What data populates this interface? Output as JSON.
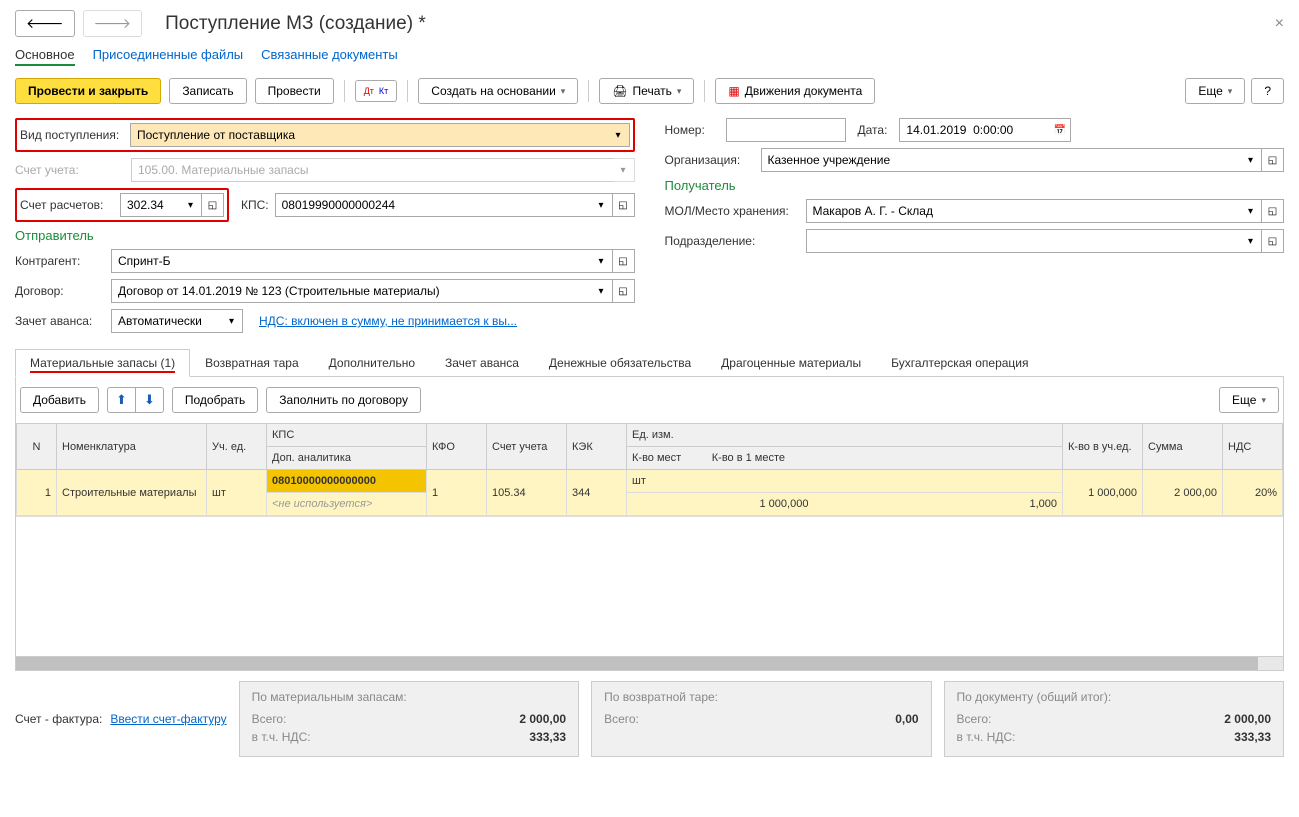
{
  "header": {
    "title": "Поступление МЗ (создание) *"
  },
  "subnav": {
    "main": "Основное",
    "files": "Присоединенные файлы",
    "linked": "Связанные документы"
  },
  "toolbar": {
    "post_close": "Провести и закрыть",
    "write": "Записать",
    "post": "Провести",
    "create_based": "Создать на основании",
    "print": "Печать",
    "movements": "Движения документа",
    "more": "Еще",
    "help": "?"
  },
  "form": {
    "receipt_type_label": "Вид поступления:",
    "receipt_type_value": "Поступление от поставщика",
    "account_label": "Счет учета:",
    "account_value": "105.00. Материальные запасы",
    "settle_account_label": "Счет расчетов:",
    "settle_account_value": "302.34",
    "kps_label": "КПС:",
    "kps_value": "08019990000000244",
    "sender_title": "Отправитель",
    "counterparty_label": "Контрагент:",
    "counterparty_value": "Спринт-Б",
    "contract_label": "Договор:",
    "contract_value": "Договор от 14.01.2019 № 123 (Строительные материалы)",
    "advance_label": "Зачет аванса:",
    "advance_value": "Автоматически",
    "vat_link": "НДС: включен в сумму, не принимается к вы...",
    "number_label": "Номер:",
    "number_value": "",
    "date_label": "Дата:",
    "date_value": "14.01.2019  0:00:00",
    "org_label": "Организация:",
    "org_value": "Казенное учреждение",
    "receiver_title": "Получатель",
    "mol_label": "МОЛ/Место хранения:",
    "mol_value": "Макаров А. Г. - Склад",
    "dept_label": "Подразделение:",
    "dept_value": ""
  },
  "tabs": {
    "materials": "Материальные запасы (1)",
    "returnable": "Возвратная тара",
    "additional": "Дополнительно",
    "advance_offset": "Зачет аванса",
    "money_obligations": "Денежные обязательства",
    "precious": "Драгоценные материалы",
    "accounting": "Бухгалтерская операция"
  },
  "tab_toolbar": {
    "add": "Добавить",
    "select": "Подобрать",
    "fill_contract": "Заполнить по договору",
    "more": "Еще"
  },
  "grid": {
    "headers": {
      "n": "N",
      "nomenclature": "Номенклатура",
      "unit": "Уч. ед.",
      "kps": "КПС",
      "kfo": "КФО",
      "account": "Счет учета",
      "kek": "КЭК",
      "unit_meas": "Ед. изм.",
      "qty_unit": "К-во в уч.ед.",
      "sum": "Сумма",
      "vat": "НДС",
      "dop_analytics": "Доп. аналитика",
      "qty_places": "К-во мест",
      "qty_per_place": "К-во в 1 месте"
    },
    "row": {
      "n": "1",
      "nomenclature": "Строительные материалы",
      "unit": "шт",
      "kps": "08010000000000000",
      "kfo": "1",
      "account": "105.34",
      "kek": "344",
      "unit_meas": "шт",
      "qty": "1 000,000",
      "sum": "2 000,00",
      "vat": "20%",
      "not_used": "<не используется>",
      "qty_places": "1 000,000",
      "qty_per_place": "1,000"
    }
  },
  "footer": {
    "invoice_label": "Счет - фактура:",
    "invoice_link": "Ввести счет-фактуру",
    "sum1_title": "По материальным запасам:",
    "sum2_title": "По возвратной таре:",
    "sum3_title": "По документу (общий итог):",
    "total_label": "Всего:",
    "vat_label": "в т.ч. НДС:",
    "sum1_total": "2 000,00",
    "sum1_vat": "333,33",
    "sum2_total": "0,00",
    "sum3_total": "2 000,00",
    "sum3_vat": "333,33"
  }
}
